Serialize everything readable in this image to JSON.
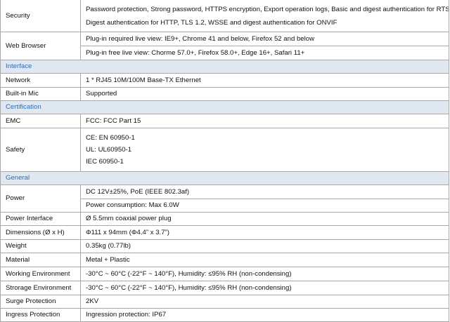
{
  "rows": [
    {
      "type": "spec",
      "label": "Security",
      "height": 46,
      "values": [
        "Password protection, Strong password, HTTPS encryption, Export operation logs, Basic and digest authentication for RTSP,",
        "Digest authentication for HTTP, TLS 1.2, WSSE and digest authentication for ONVIF"
      ],
      "split": false
    },
    {
      "type": "spec",
      "label": "Web Browser",
      "height": 40,
      "values": [
        "Plug-in required live view: IE9+, Chrome 41 and below, Firefox 52 and below",
        "Plug-in free live view: Chorme 57.0+, Firefox 58.0+, Edge 16+, Safari 11+"
      ],
      "split": true
    },
    {
      "type": "section",
      "label": "Interface"
    },
    {
      "type": "spec",
      "label": "Network",
      "values": [
        "1 * RJ45 10M/100M Base-TX Ethernet"
      ]
    },
    {
      "type": "spec",
      "label": "Built-in Mic",
      "values": [
        "Supported"
      ]
    },
    {
      "type": "section",
      "label": "Certification"
    },
    {
      "type": "spec",
      "label": "EMC",
      "values": [
        "FCC: FCC Part 15"
      ]
    },
    {
      "type": "spec",
      "label": "Safety",
      "values": [
        "CE: EN 60950-1",
        "UL: UL60950-1",
        "IEC 60950-1"
      ],
      "split": false
    },
    {
      "type": "section",
      "label": "General"
    },
    {
      "type": "spec",
      "label": "Power",
      "values": [
        "DC 12V±25%, PoE (IEEE 802.3af)",
        "Power consumption: Max 6.0W"
      ],
      "split": true
    },
    {
      "type": "spec",
      "label": "Power Interface",
      "values": [
        "Ø 5.5mm coaxial power plug"
      ]
    },
    {
      "type": "spec",
      "label": "Dimensions (Ø x H)",
      "values": [
        "Φ111 x 94mm (Φ4.4” x 3.7”)"
      ]
    },
    {
      "type": "spec",
      "label": "Weight",
      "values": [
        "0.35kg (0.77lb)"
      ]
    },
    {
      "type": "spec",
      "label": "Material",
      "values": [
        "Metal + Plastic"
      ]
    },
    {
      "type": "spec",
      "label": "Working Environment",
      "values": [
        "-30°C ~ 60°C (-22°F ~ 140°F), Humidity: ≤95% RH (non-condensing)"
      ]
    },
    {
      "type": "spec",
      "label": "Strorage Environment",
      "values": [
        "-30°C ~ 60°C (-22°F ~ 140°F), Humidity: ≤95% RH (non-condensing)"
      ]
    },
    {
      "type": "spec",
      "label": "Surge Protection",
      "values": [
        "2KV"
      ]
    },
    {
      "type": "spec",
      "label": "Ingress Protection",
      "values": [
        "Ingression protection: IP67"
      ]
    }
  ]
}
